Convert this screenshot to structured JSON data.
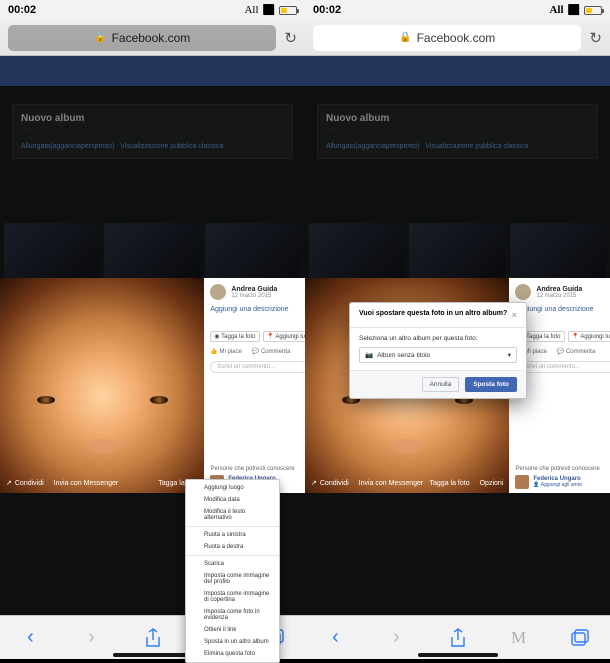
{
  "status": {
    "time": "00:02",
    "network": "All"
  },
  "address_bar": {
    "domain": "Facebook.com"
  },
  "fb_page": {
    "title": "Nuovo album",
    "meta1": "Allungato(agganciaperspento)",
    "meta2": "Visualizzazione pubblica classica"
  },
  "viewer": {
    "user_name": "Andrea Guida",
    "post_date": "12 marzo 2015",
    "add_description": "Aggiungi una descrizione",
    "tag_photo": "Tagga la foto",
    "add_location": "Aggiungi lu...",
    "like": "Mi piace",
    "comment": "Commenta",
    "comment_placeholder": "Scrivi un commento...",
    "suggest_title": "Persone che potresti conoscere",
    "suggest_name": "Federica Ungaro",
    "suggest_add": "Aggiungi agli amici",
    "footer_share": "Condividi",
    "footer_send": "Invia con Messenger",
    "footer_tag": "Tagga la foto",
    "footer_options": "Opzioni"
  },
  "context_menu": {
    "items_top": [
      "Aggiungi luogo",
      "Modifica data",
      "Modifica il testo alternativo"
    ],
    "items_mid": [
      "Ruota a sinistra",
      "Ruota a destra"
    ],
    "items_bot": [
      "Scarica",
      "Imposta come immagine del profilo",
      "Imposta come immagine di copertina",
      "Imposta come foto in evidenza",
      "Ottieni il link",
      "Sposta in un altro album",
      "Elimina questa foto"
    ]
  },
  "dialog": {
    "title": "Vuoi spostare questa foto in un altro album?",
    "prompt": "Seleziona un altro album per questa foto:",
    "selected": "Album senza titolo",
    "cancel": "Annulla",
    "confirm": "Sposta foto"
  }
}
